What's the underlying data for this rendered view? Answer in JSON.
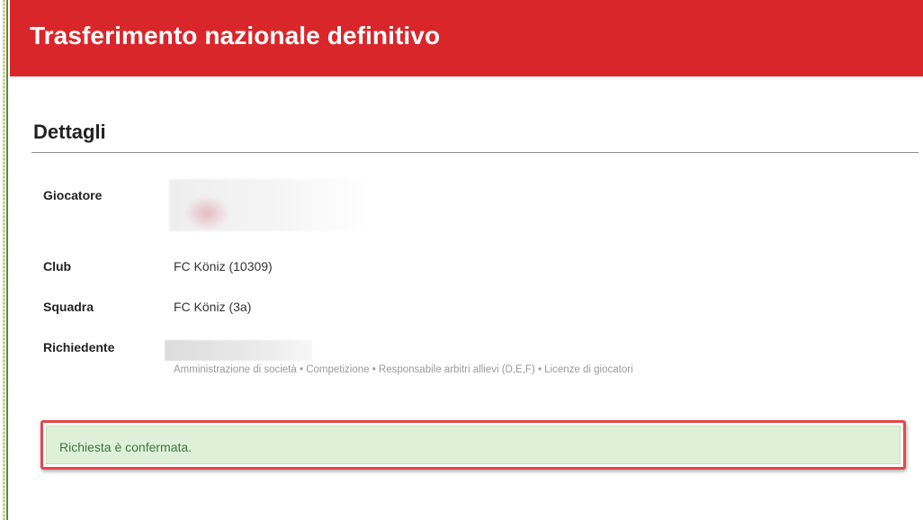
{
  "header": {
    "title": "Trasferimento nazionale definitivo",
    "background_color": "#d9262a"
  },
  "details": {
    "section_title": "Dettagli",
    "rows": [
      {
        "label": "Giocatore",
        "value": ""
      },
      {
        "label": "Club",
        "value": "FC Köniz (10309)"
      },
      {
        "label": "Squadra",
        "value": "FC Köniz (3a)"
      },
      {
        "label": "Richiedente",
        "value": ""
      }
    ],
    "requester_roles": "Amministrazione di società • Competizione • Responsabile arbitri allievi (D,E,F) • Licenze di giocatori"
  },
  "alert": {
    "message": "Richiesta è confermata.",
    "background_color": "#dff0d8",
    "text_color": "#3c763d",
    "highlight_border_color": "#e4474e"
  }
}
